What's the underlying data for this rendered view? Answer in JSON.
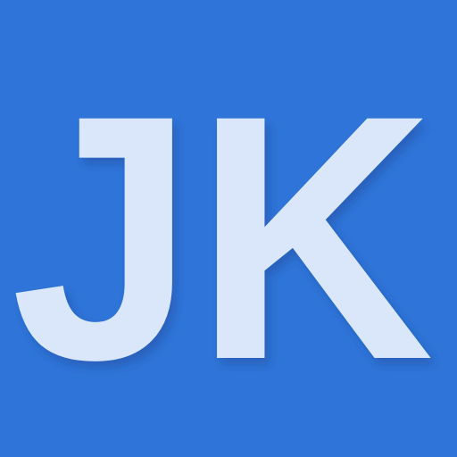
{
  "avatar": {
    "initials": "JK",
    "background_color": "#2f74d8",
    "text_color": "#dae7fb",
    "shadow_color": "#123d86"
  }
}
